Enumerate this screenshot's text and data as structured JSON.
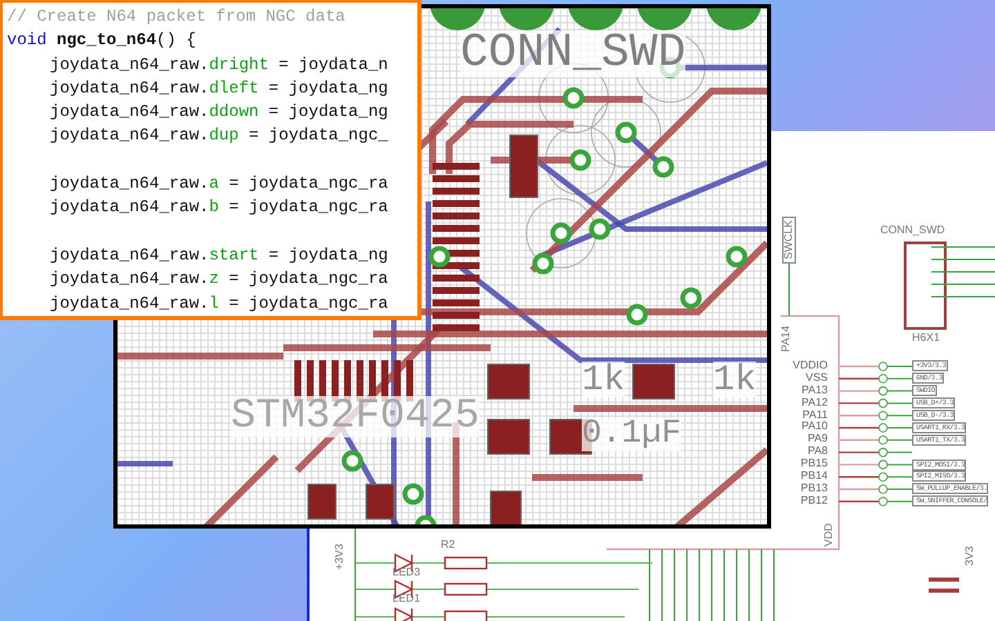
{
  "code_editor": {
    "comment": "// Create N64 packet from NGC data",
    "signature": {
      "keyword": "void",
      "name": "ngc_to_n64",
      "rest": "() {"
    },
    "lines": [
      {
        "kind": "assign",
        "object": "joydata_n64_raw.",
        "field": "dright",
        "rest": " = joydata_n"
      },
      {
        "kind": "assign",
        "object": "joydata_n64_raw.",
        "field": "dleft",
        "rest": " = joydata_ng"
      },
      {
        "kind": "assign",
        "object": "joydata_n64_raw.",
        "field": "ddown",
        "rest": " = joydata_ng"
      },
      {
        "kind": "assign",
        "object": "joydata_n64_raw.",
        "field": "dup",
        "rest": " = joydata_ngc_"
      },
      {
        "kind": "blank"
      },
      {
        "kind": "assign",
        "object": "joydata_n64_raw.",
        "field": "a",
        "rest": " = joydata_ngc_ra"
      },
      {
        "kind": "assign",
        "object": "joydata_n64_raw.",
        "field": "b",
        "rest": " = joydata_ngc_ra"
      },
      {
        "kind": "blank"
      },
      {
        "kind": "assign",
        "object": "joydata_n64_raw.",
        "field": "start",
        "rest": " = joydata_ng"
      },
      {
        "kind": "assign",
        "object": "joydata_n64_raw.",
        "field": "z",
        "rest": " = joydata_ngc_ra"
      },
      {
        "kind": "assign",
        "object": "joydata_n64_raw.",
        "field": "l",
        "rest": " = joydata_ngc_ra"
      }
    ]
  },
  "pcb_layout": {
    "labels": [
      {
        "kind": "connector",
        "text": "CONN_SWD"
      },
      {
        "kind": "chip",
        "text": "STM32F0425"
      },
      {
        "kind": "value",
        "text": "1k"
      },
      {
        "kind": "value",
        "text": "1k"
      },
      {
        "kind": "value",
        "text": "0.1µF"
      }
    ]
  },
  "schematic": {
    "connector": {
      "name": "CONN_SWD",
      "part": "H6X1"
    },
    "swclk": "SWCLK",
    "top_pin": "PA14",
    "bottom_pin": "VDD",
    "pins": [
      {
        "name": "VDDIO",
        "net": "+3V3/3.3"
      },
      {
        "name": "VSS",
        "net": "GND/3.3"
      },
      {
        "name": "PA13",
        "net": "SWDIO"
      },
      {
        "name": "PA12",
        "net": "USB_D+/3.3"
      },
      {
        "name": "PA11",
        "net": "USB_D-/3.3"
      },
      {
        "name": "PA10",
        "net": "USART1_RX/3.3"
      },
      {
        "name": "PA9",
        "net": "USART1_TX/3.3"
      },
      {
        "name": "PA8"
      },
      {
        "name": "PB15",
        "net": "SPI2_MOSI/3.3"
      },
      {
        "name": "PB14",
        "net": "SPI2_MISO/3.3"
      },
      {
        "name": "PB13",
        "net": "SW_PULLUP_ENABLE/3."
      },
      {
        "name": "PB12",
        "net": "SW_SNIFFER_CONSOLE/"
      }
    ],
    "power": [
      "+3V3",
      "3V3"
    ],
    "parts": [
      {
        "kind": "resistor",
        "text": "R2"
      },
      {
        "kind": "led",
        "text": "LED3"
      },
      {
        "kind": "led",
        "text": "LED1"
      }
    ]
  }
}
